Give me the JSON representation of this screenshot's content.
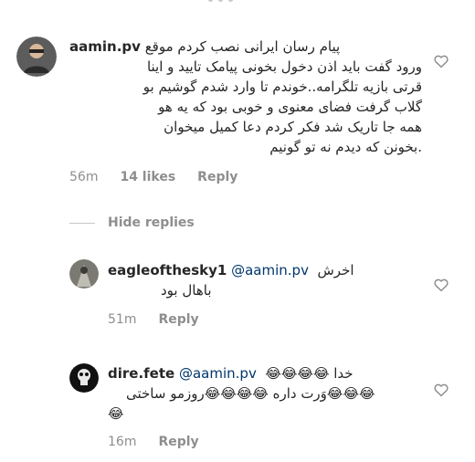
{
  "comments": [
    {
      "username": "aamin.pv",
      "lines": [
        "پیام رسان ایرانی نصب کردم موقع",
        "ورود گفت باید اذن دخول بخونی پیامک تایید و اینا",
        "قرتی بازیه تلگرامه..خوندم تا وارد شدم گوشیم بو",
        "گلاب گرفت فضای معنوی و خوبی بود که یه هو",
        "همه جا تاریک شد فکر کردم دعا کمیل میخوان",
        ".بخونن که دیدم نه تو گونیم"
      ],
      "time": "56m",
      "likes": "14 likes",
      "reply": "Reply"
    }
  ],
  "hide_replies": "Hide replies",
  "replies": [
    {
      "username": "eagleofthesky1",
      "mention": "@aamin.pv",
      "lines": [
        "اخرش",
        "باهال بود"
      ],
      "time": "51m",
      "reply": "Reply"
    },
    {
      "username": "dire.fete",
      "mention": "@aamin.pv",
      "lines": [
        "خدا 😂😂😂😂",
        "😂😂😂وَرت داره 😂😂😂😂روزمو ساختی",
        "😂"
      ],
      "time": "16m",
      "reply": "Reply"
    }
  ]
}
